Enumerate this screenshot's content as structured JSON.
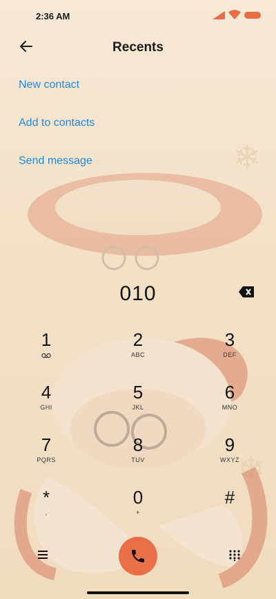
{
  "status_bar": {
    "time": "2:36 AM"
  },
  "header": {
    "title": "Recents"
  },
  "actions": {
    "new_contact": "New contact",
    "add_to_contacts": "Add to contacts",
    "send_message": "Send message"
  },
  "dialer": {
    "number": "010"
  },
  "keypad": [
    {
      "num": "1",
      "sub": ""
    },
    {
      "num": "2",
      "sub": "ABC"
    },
    {
      "num": "3",
      "sub": "DEF"
    },
    {
      "num": "4",
      "sub": "GHI"
    },
    {
      "num": "5",
      "sub": "JKL"
    },
    {
      "num": "6",
      "sub": "MNO"
    },
    {
      "num": "7",
      "sub": "PQRS"
    },
    {
      "num": "8",
      "sub": "TUV"
    },
    {
      "num": "9",
      "sub": "WXYZ"
    },
    {
      "num": "*",
      "sub": ","
    },
    {
      "num": "0",
      "sub": "+"
    },
    {
      "num": "#",
      "sub": ""
    }
  ],
  "icons": {
    "back": "back-arrow-icon",
    "backspace": "backspace-icon",
    "menu": "menu-icon",
    "call": "phone-icon",
    "dialpad": "dialpad-icon",
    "voicemail": "voicemail-icon"
  },
  "colors": {
    "accent": "#1e88e5",
    "call_button": "#e96f47",
    "battery": "#e86d44"
  }
}
